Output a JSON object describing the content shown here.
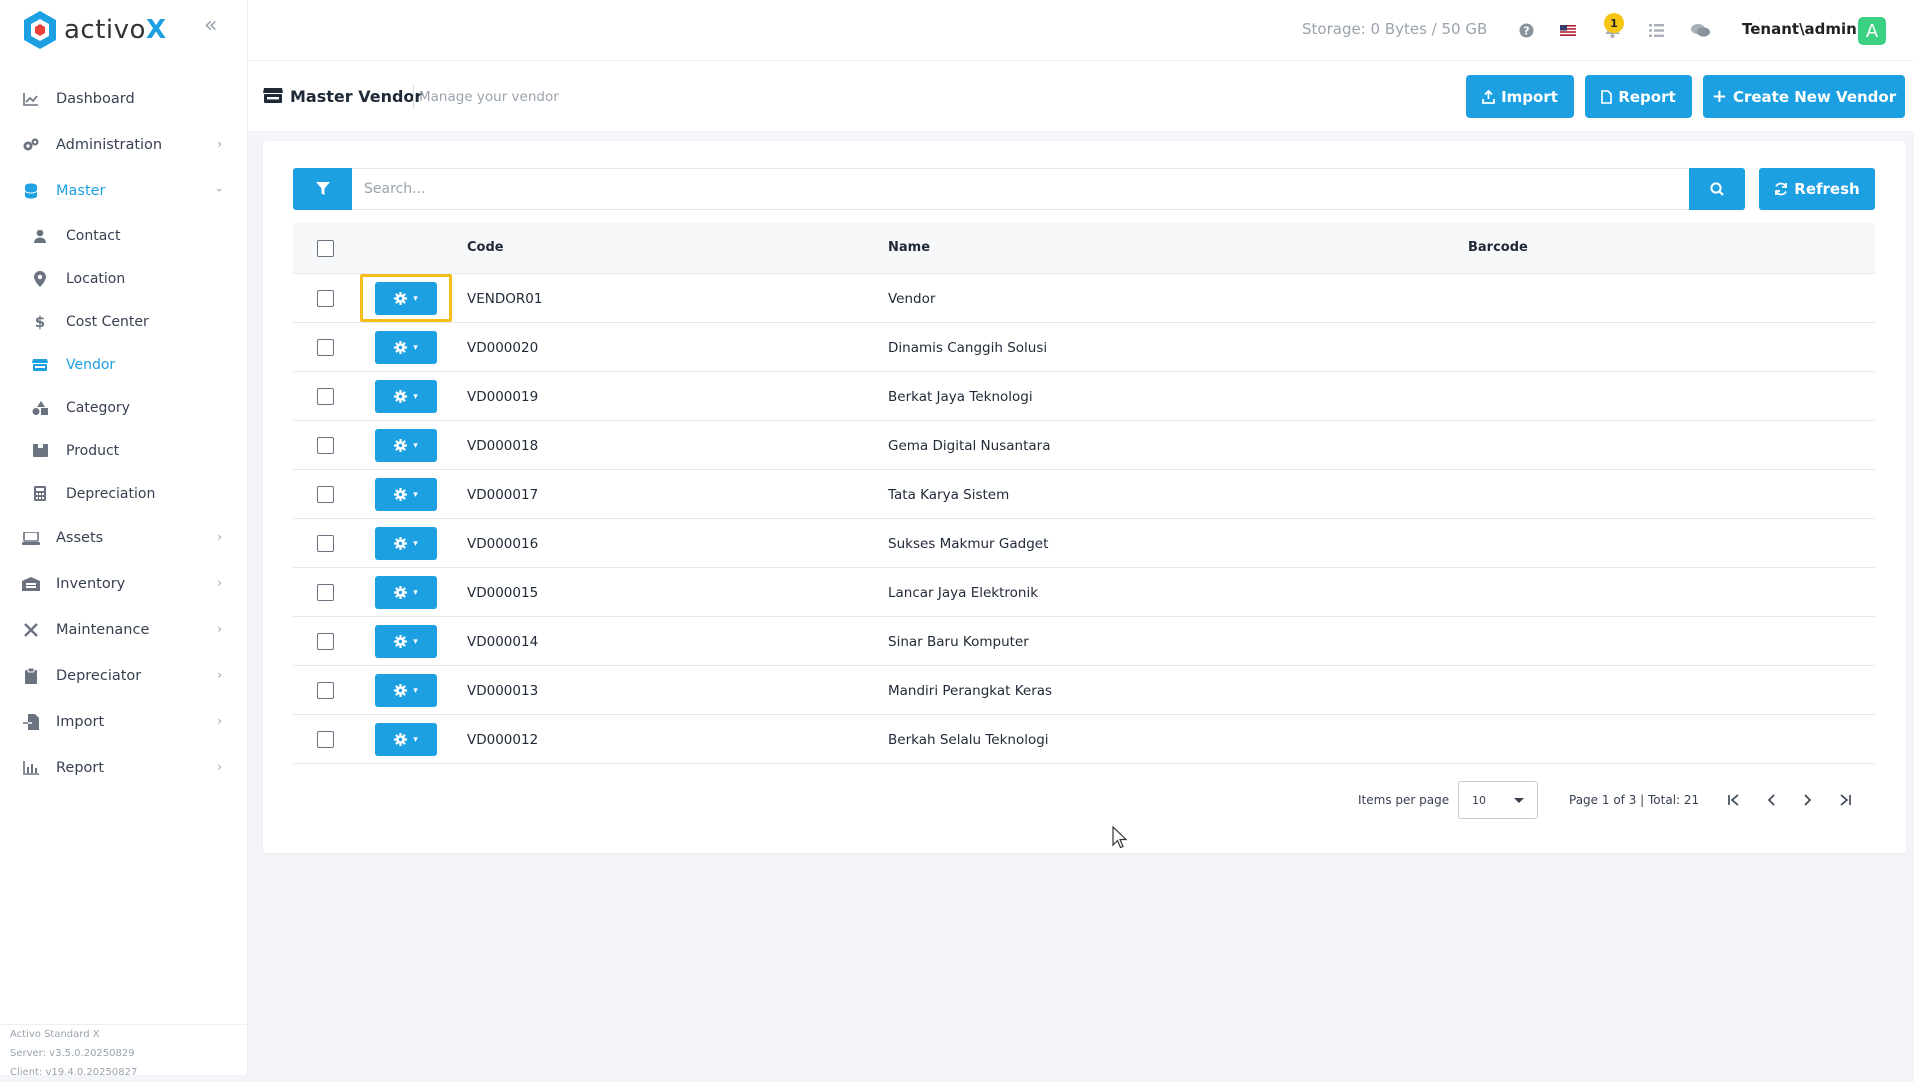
{
  "brand": {
    "logo_text_prefix": "activo",
    "logo_text_suffix": "X",
    "accent": "#1ca0e2"
  },
  "sidebar": {
    "items": [
      {
        "label": "Dashboard",
        "icon": "chart-line-icon",
        "has_children": false
      },
      {
        "label": "Administration",
        "icon": "gears-icon",
        "has_children": true
      },
      {
        "label": "Master",
        "icon": "database-icon",
        "has_children": true,
        "expanded": true,
        "active": true
      },
      {
        "label": "Assets",
        "icon": "laptop-icon",
        "has_children": true
      },
      {
        "label": "Inventory",
        "icon": "warehouse-icon",
        "has_children": true
      },
      {
        "label": "Maintenance",
        "icon": "tools-icon",
        "has_children": true
      },
      {
        "label": "Depreciator",
        "icon": "clipboard-icon",
        "has_children": true
      },
      {
        "label": "Import",
        "icon": "file-import-icon",
        "has_children": true
      },
      {
        "label": "Report",
        "icon": "chart-bar-icon",
        "has_children": true
      }
    ],
    "master_sub": [
      {
        "label": "Contact",
        "icon": "user-icon"
      },
      {
        "label": "Location",
        "icon": "map-pin-icon"
      },
      {
        "label": "Cost Center",
        "icon": "dollar-icon"
      },
      {
        "label": "Vendor",
        "icon": "store-icon",
        "active": true
      },
      {
        "label": "Category",
        "icon": "shapes-icon"
      },
      {
        "label": "Product",
        "icon": "box-icon"
      },
      {
        "label": "Depreciation",
        "icon": "calculator-icon"
      }
    ],
    "footer": {
      "edition": "Activo Standard X",
      "server": "Server: v3.5.0.20250829",
      "client": "Client: v19.4.0.20250827"
    }
  },
  "topbar": {
    "storage": "Storage: 0 Bytes / 50 GB",
    "notification_count": "1",
    "tenant": "Tenant\\admin",
    "avatar_letter": "A"
  },
  "header": {
    "title": "Master Vendor",
    "subtitle": "Manage your vendor",
    "buttons": {
      "import": "Import",
      "report": "Report",
      "create": "Create New Vendor"
    }
  },
  "toolbar": {
    "search_placeholder": "Search...",
    "refresh": "Refresh"
  },
  "table": {
    "columns": {
      "code": "Code",
      "name": "Name",
      "barcode": "Barcode"
    },
    "rows": [
      {
        "code": "VENDOR01",
        "name": "Vendor",
        "barcode": ""
      },
      {
        "code": "VD000020",
        "name": "Dinamis Canggih Solusi",
        "barcode": ""
      },
      {
        "code": "VD000019",
        "name": "Berkat Jaya Teknologi",
        "barcode": ""
      },
      {
        "code": "VD000018",
        "name": "Gema Digital Nusantara",
        "barcode": ""
      },
      {
        "code": "VD000017",
        "name": "Tata Karya Sistem",
        "barcode": ""
      },
      {
        "code": "VD000016",
        "name": "Sukses Makmur Gadget",
        "barcode": ""
      },
      {
        "code": "VD000015",
        "name": "Lancar Jaya Elektronik",
        "barcode": ""
      },
      {
        "code": "VD000014",
        "name": "Sinar Baru Komputer",
        "barcode": ""
      },
      {
        "code": "VD000013",
        "name": "Mandiri Perangkat Keras",
        "barcode": ""
      },
      {
        "code": "VD000012",
        "name": "Berkah Selalu Teknologi",
        "barcode": ""
      }
    ]
  },
  "pager": {
    "items_per_page_label": "Items per page",
    "items_per_page": "10",
    "page_info": "Page 1 of 3 | Total: 21"
  }
}
